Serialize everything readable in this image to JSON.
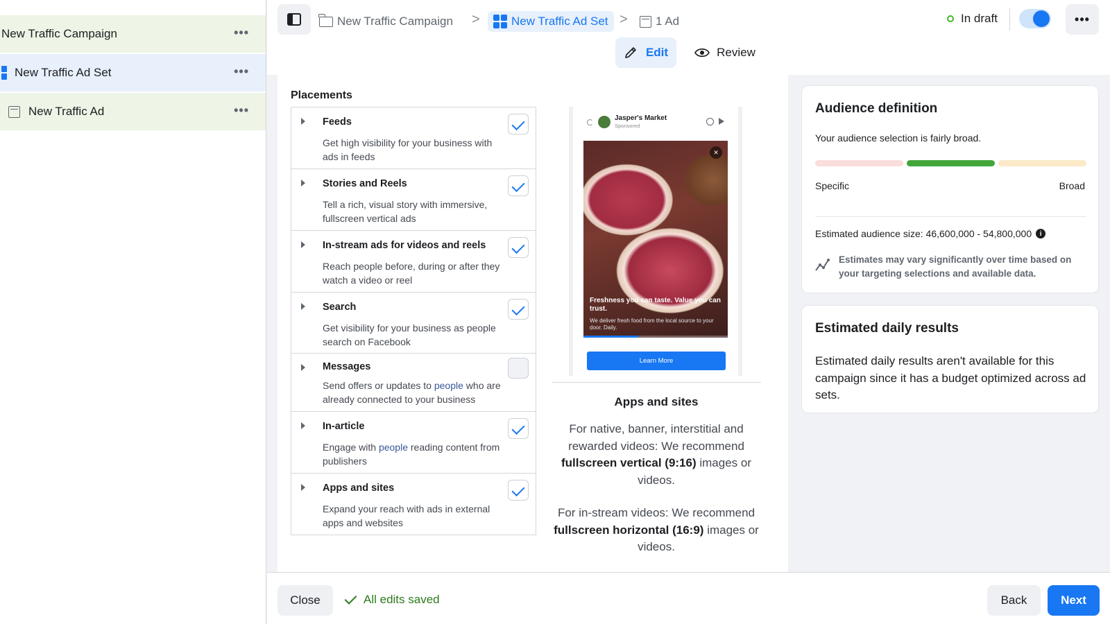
{
  "sidebar": {
    "campaign": {
      "label": "New Traffic Campaign",
      "more": "•••"
    },
    "adset": {
      "label": "New Traffic Ad Set",
      "more": "•••"
    },
    "ad": {
      "label": "New Traffic Ad",
      "more": "•••"
    }
  },
  "header": {
    "breadcrumb": {
      "campaign": "New Traffic Campaign",
      "adset": "New Traffic Ad Set",
      "ad": "1 Ad",
      "separator": ">"
    },
    "status": "In draft",
    "more": "•••"
  },
  "tabs": {
    "edit": "Edit",
    "review": "Review"
  },
  "placements": {
    "title": "Placements",
    "items": [
      {
        "name": "Feeds",
        "desc": "Get high visibility for your business with ads in feeds",
        "checked": true
      },
      {
        "name": "Stories and Reels",
        "desc": "Tell a rich, visual story with immersive, fullscreen vertical ads",
        "checked": true
      },
      {
        "name": "In-stream ads for videos and reels",
        "desc": "Reach people before, during or after they watch a video or reel",
        "checked": true
      },
      {
        "name": "Search",
        "desc": "Get visibility for your business as people search on Facebook",
        "checked": true
      },
      {
        "name": "Messages",
        "desc_pre": "Send offers or updates to ",
        "desc_link": "people",
        "desc_post": " who are already connected to your business",
        "checked": false
      },
      {
        "name": "In-article",
        "desc_pre": "Engage with ",
        "desc_link": "people",
        "desc_post": " reading content from publishers",
        "checked": true
      },
      {
        "name": "Apps and sites",
        "desc": "Expand your reach with ads in external apps and websites",
        "checked": true
      }
    ]
  },
  "preview": {
    "brand": "Jasper's Market",
    "sponsored": "Sponsored",
    "headline": "Freshness you can taste. Value you can trust.",
    "subtext": "We deliver fresh food from the local source to your door. Daily.",
    "cta": "Learn More",
    "progress": 0.38,
    "title": "Apps and sites",
    "rec1_pre": "For native, banner, interstitial and rewarded videos: We recommend ",
    "rec1_bold": "fullscreen vertical (9:16)",
    "rec1_post": " images or videos.",
    "rec2_pre": "For in-stream videos: We recommend ",
    "rec2_bold": "fullscreen horizontal (16:9)",
    "rec2_post": " images or videos."
  },
  "audience": {
    "title": "Audience definition",
    "desc": "Your audience selection is fairly broad.",
    "meter_low": "Specific",
    "meter_high": "Broad",
    "meter_colors": [
      "#f9dedb",
      "#42a63a",
      "#fbe9c8"
    ],
    "size": "Estimated audience size: 46,600,000 - 54,800,000",
    "note": "Estimates may vary significantly over time based on your targeting selections and available data."
  },
  "daily": {
    "title": "Estimated daily results",
    "text": "Estimated daily results aren't available for this campaign since it has a budget optimized across ad sets."
  },
  "footer": {
    "close": "Close",
    "saved": "All edits saved",
    "back": "Back",
    "next": "Next"
  },
  "colors": {
    "accent": "#1877f2",
    "success": "#2d7a1c",
    "draft_dot": "#42b72a"
  },
  "icons": [
    "panel-toggle-icon",
    "folder-icon",
    "grid-icon",
    "ad-icon",
    "pencil-icon",
    "eye-icon",
    "info-icon",
    "trend-icon",
    "check-icon",
    "mute-icon",
    "share-icon"
  ]
}
